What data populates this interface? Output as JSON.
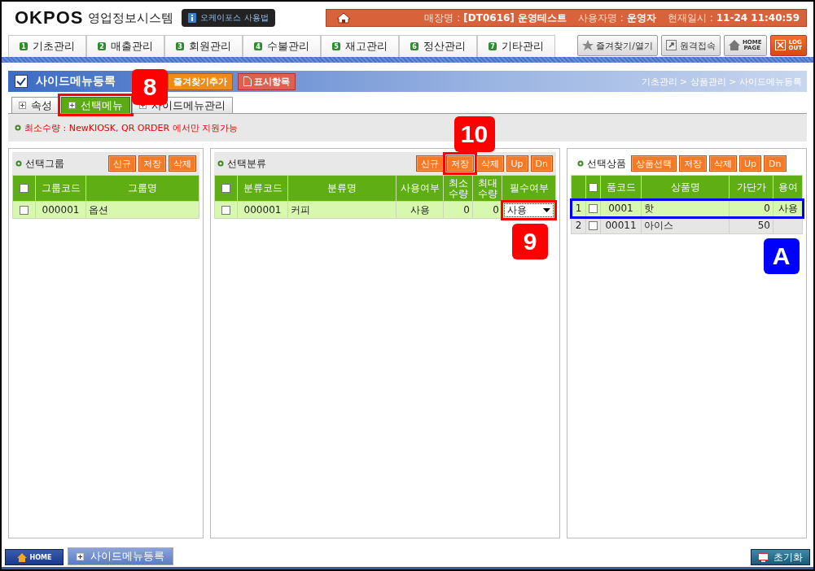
{
  "header": {
    "logo": "OKPOS",
    "system_name": "영업정보시스템",
    "help_button": "오케이포스 사용법",
    "info": [
      {
        "label": "매장명 :",
        "value": "[DT0616] 운영테스트"
      },
      {
        "label": "사용자명 :",
        "value": "운영자"
      },
      {
        "label": "현재일시 :",
        "value": "11-24 11:40:59"
      }
    ]
  },
  "menu_tabs": [
    {
      "number": "1",
      "label": "기초관리"
    },
    {
      "number": "2",
      "label": "매출관리"
    },
    {
      "number": "3",
      "label": "회원관리"
    },
    {
      "number": "4",
      "label": "수불관리"
    },
    {
      "number": "5",
      "label": "재고관리"
    },
    {
      "number": "6",
      "label": "정산관리"
    },
    {
      "number": "7",
      "label": "기타관리"
    }
  ],
  "tool_buttons": [
    {
      "kind": "favorite",
      "lines": [
        "즐겨찾기/열기"
      ]
    },
    {
      "kind": "remote",
      "lines": [
        "원격접속"
      ]
    },
    {
      "kind": "homepage",
      "lines": [
        "HOME",
        "PAGE"
      ]
    },
    {
      "kind": "logout",
      "lines": [
        "LOG",
        "OUT"
      ]
    }
  ],
  "page": {
    "title": "사이드메뉴등록",
    "buttons": [
      {
        "kind": "favorite",
        "label": "즐겨찾기추가"
      },
      {
        "kind": "display",
        "label": "표시항목"
      }
    ],
    "breadcrumb": "기초관리 > 상품관리 > 사이드메뉴등록"
  },
  "sub_tabs": [
    {
      "label": "속성",
      "selected": false
    },
    {
      "label": "선택메뉴",
      "selected": true,
      "callout": {
        "label": "8",
        "color": "#ff0000"
      }
    },
    {
      "label": "사이드메뉴관리",
      "selected": false
    }
  ],
  "notice": "최소수량 : NewKIOSK, QR ORDER 에서만 지원가능",
  "panels": [
    {
      "title": "선택그룹",
      "all_checked": false,
      "buttons": [
        {
          "label": "신규"
        },
        {
          "label": "저장"
        },
        {
          "label": "삭제"
        }
      ],
      "columns": [
        {
          "kind": "check"
        },
        {
          "kind": "code",
          "label": "그룹코드"
        },
        {
          "kind": "name",
          "label": "그룹명"
        }
      ],
      "rows": [
        {
          "selected": true,
          "checked": false,
          "cells": [
            "",
            "000001",
            "옵션"
          ]
        }
      ]
    },
    {
      "title": "선택분류",
      "all_checked": false,
      "buttons": [
        {
          "label": "신규"
        },
        {
          "label": "저장",
          "callout": {
            "label": "10",
            "color": "#ff0000"
          }
        },
        {
          "label": "삭제"
        },
        {
          "label": "Up"
        },
        {
          "label": "Dn"
        }
      ],
      "columns": [
        {
          "kind": "check"
        },
        {
          "kind": "code",
          "label": "분류코드"
        },
        {
          "kind": "name",
          "label": "분류명"
        },
        {
          "kind": "center",
          "label": "사용여부"
        },
        {
          "kind": "number",
          "label": "최소\n수량"
        },
        {
          "kind": "number",
          "label": "최대\n수량"
        },
        {
          "kind": "select",
          "label": "필수여부"
        }
      ],
      "rows": [
        {
          "selected": true,
          "checked": false,
          "cells": [
            "",
            "000001",
            "커피",
            "사용",
            "0",
            "0",
            "사용"
          ],
          "callout": {
            "label": "9",
            "color": "#ff0000"
          }
        }
      ]
    },
    {
      "title": "선택상품",
      "all_checked": false,
      "buttons": [
        {
          "label": "상품선택"
        },
        {
          "label": "저장"
        },
        {
          "label": "삭제"
        },
        {
          "label": "Up"
        },
        {
          "label": "Dn"
        }
      ],
      "columns": [
        {
          "kind": "no"
        },
        {
          "kind": "check"
        },
        {
          "kind": "code",
          "label": "품코드"
        },
        {
          "kind": "name",
          "label": "상품명"
        },
        {
          "kind": "number",
          "label": "가단가"
        },
        {
          "kind": "center",
          "label": "용여"
        }
      ],
      "rows": [
        {
          "selected": true,
          "checked": false,
          "cells": [
            "1",
            "",
            "0001",
            "핫",
            "0",
            "사용"
          ],
          "callout": {
            "label": "A",
            "color": "#0000ff"
          }
        },
        {
          "selected": false,
          "checked": false,
          "cells": [
            "2",
            "",
            "00011",
            "아이스",
            "50",
            ""
          ]
        }
      ]
    }
  ],
  "footer": {
    "home": "HOME",
    "window_tab": "사이드메뉴등록",
    "reset": "초기화"
  }
}
